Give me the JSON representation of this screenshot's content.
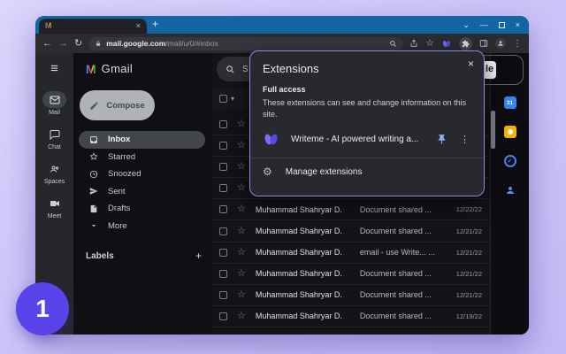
{
  "colors": {
    "accent_purple": "#9087f0",
    "badge_purple": "#5a43e8",
    "titlebar_blue": "#1565a3",
    "pin_blue": "#8ab4f8",
    "calendar_blue": "#3086f4",
    "keep_yellow": "#f5b400"
  },
  "icons": {
    "hamburger": "≡",
    "star": "☆",
    "caret": "▾",
    "dots": "⋮",
    "gear": "⚙",
    "close": "×",
    "plus": "+",
    "back": "←",
    "forward": "→",
    "reload": "↻",
    "minimize": "—",
    "tab_search": "⌄",
    "check": "✓"
  },
  "badge": {
    "number": "1"
  },
  "browser": {
    "tab": {
      "title": ""
    },
    "url": {
      "origin": "mail.google.com",
      "path": "/mail/u/0/#inbox"
    }
  },
  "popup": {
    "title": "Extensions",
    "section_title": "Full access",
    "description": "These extensions can see and change information on this site.",
    "extension_name": "Writeme - AI powered writing a...",
    "manage_label": "Manage extensions"
  },
  "gmail": {
    "logo_letter": "M",
    "logo_word": "Gmail",
    "compose_label": "Compose",
    "search_text": "S",
    "header_badge": "le",
    "labels_header": "Labels",
    "side_panel": {
      "calendar_label": "31"
    },
    "rail": [
      {
        "icon": "envelope",
        "label": "Mail",
        "active": true
      },
      {
        "icon": "chat",
        "label": "Chat"
      },
      {
        "icon": "spaces",
        "label": "Spaces"
      },
      {
        "icon": "meet",
        "label": "Meet"
      }
    ],
    "nav": [
      {
        "icon": "inbox",
        "label": "Inbox",
        "active": true
      },
      {
        "icon": "starline",
        "label": "Starred"
      },
      {
        "icon": "clock",
        "label": "Snoozed"
      },
      {
        "icon": "send",
        "label": "Sent"
      },
      {
        "icon": "file",
        "label": "Drafts"
      },
      {
        "icon": "chevron",
        "label": "More"
      }
    ],
    "rows": [
      {
        "sender": "",
        "subject": "",
        "date": ""
      },
      {
        "sender": "",
        "subject": "",
        "date": ""
      },
      {
        "sender": "",
        "subject": "",
        "date": ""
      },
      {
        "sender": "",
        "subject": "",
        "date": ""
      },
      {
        "sender": "Muhammad Shahryar D.",
        "subject": "Document shared ...",
        "date": "12/22/22"
      },
      {
        "sender": "Muhammad Shahryar D.",
        "subject": "Document shared ...",
        "date": "12/21/22"
      },
      {
        "sender": "Muhammad Shahryar D.",
        "subject": "email - use Write... ...",
        "date": "12/21/22"
      },
      {
        "sender": "Muhammad Shahryar D.",
        "subject": "Document shared ...",
        "date": "12/21/22"
      },
      {
        "sender": "Muhammad Shahryar D.",
        "subject": "Document shared ...",
        "date": "12/21/22"
      },
      {
        "sender": "Muhammad Shahryar D.",
        "subject": "Document shared ...",
        "date": "12/19/22"
      }
    ]
  }
}
